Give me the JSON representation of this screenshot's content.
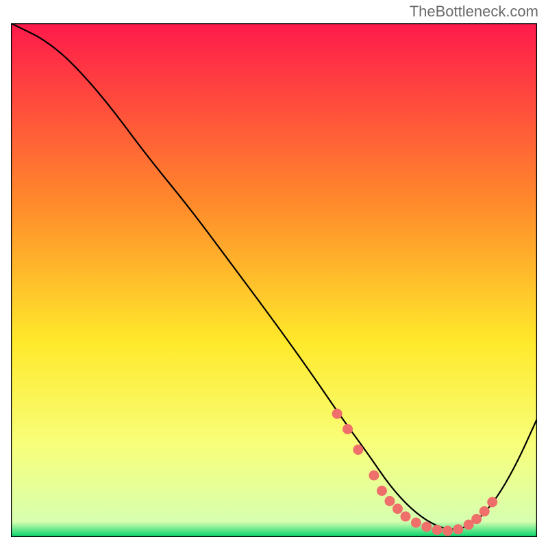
{
  "attribution": "TheBottleneck.com",
  "chart_data": {
    "type": "line",
    "title": "",
    "xlabel": "",
    "ylabel": "",
    "xlim": [
      0,
      100
    ],
    "ylim": [
      0,
      100
    ],
    "gradient_colors": {
      "top": "#ff1a4b",
      "upper_mid": "#ff8a2b",
      "mid": "#ffe92b",
      "lower": "#f8ff7a",
      "bottom": "#00d46a"
    },
    "series": [
      {
        "name": "curve",
        "x": [
          0,
          2,
          6,
          11,
          18,
          26,
          34,
          42,
          50,
          57,
          63,
          68,
          72,
          76,
          80,
          84,
          88,
          92,
          96,
          100
        ],
        "y": [
          100,
          99,
          97,
          93,
          85,
          74,
          64,
          53,
          42,
          32,
          23,
          16,
          10,
          5.5,
          2.5,
          1.2,
          2.5,
          7,
          14,
          23
        ]
      }
    ],
    "markers": {
      "name": "highlight-dots",
      "color": "#ef6f6a",
      "x": [
        62,
        64,
        66,
        69,
        70.5,
        72,
        73.5,
        75,
        77,
        79,
        81,
        83,
        85,
        87,
        88.5,
        90,
        91.5
      ],
      "y": [
        24,
        21,
        17,
        12,
        9,
        7,
        5.5,
        4,
        2.8,
        2,
        1.4,
        1.2,
        1.5,
        2.4,
        3.5,
        5,
        6.8
      ]
    }
  }
}
